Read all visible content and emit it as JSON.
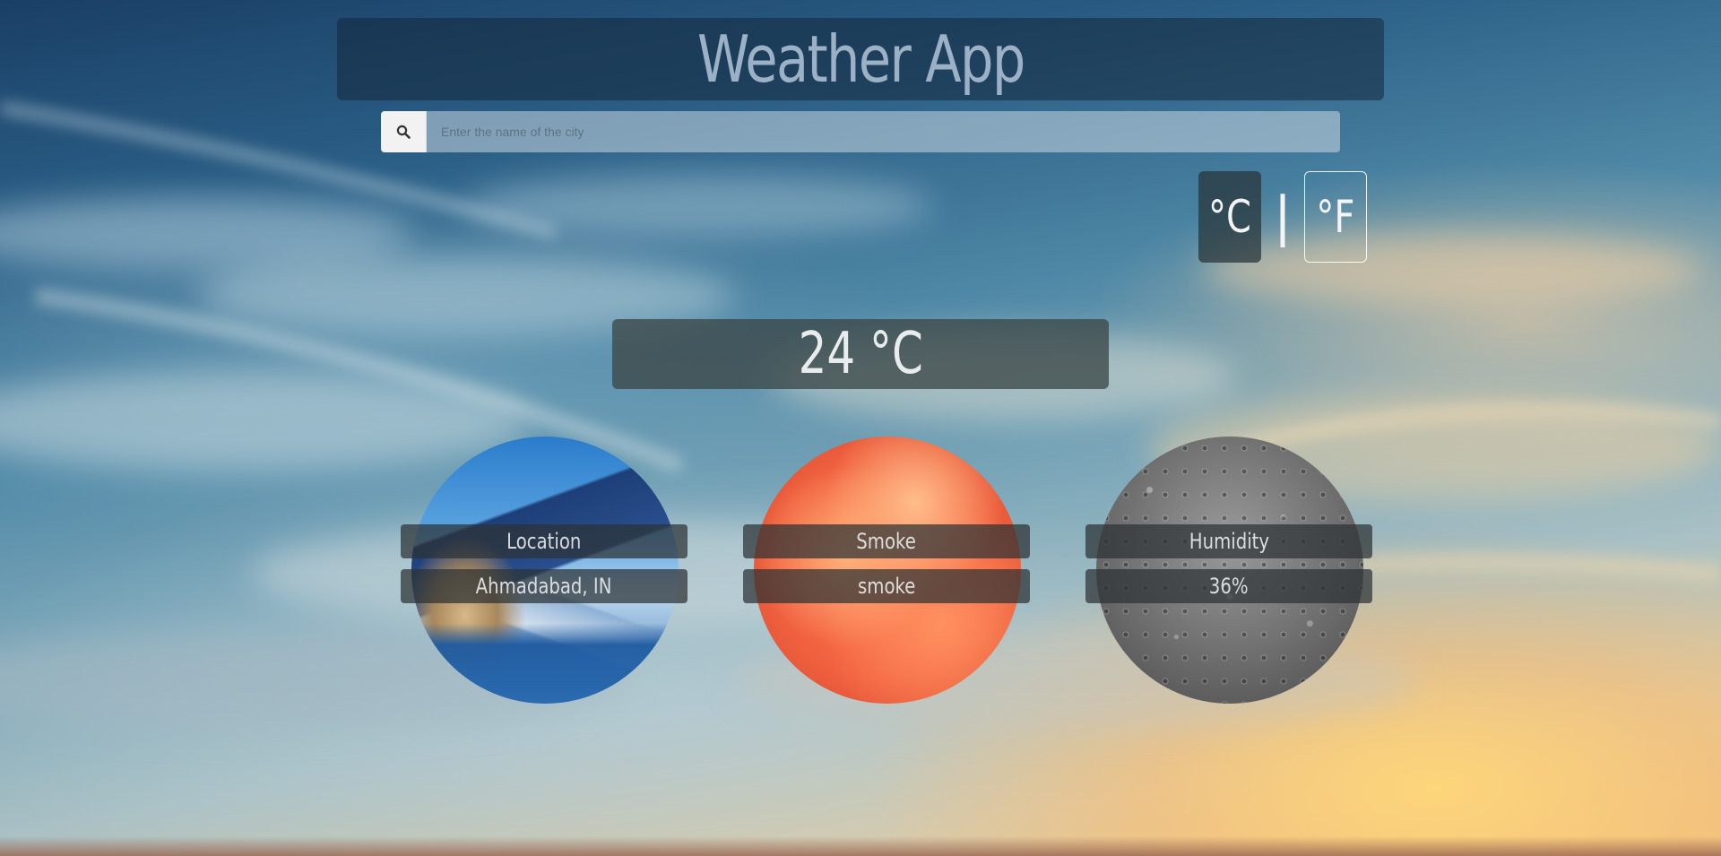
{
  "header": {
    "title": "Weather App"
  },
  "search": {
    "icon": "search-icon",
    "placeholder": "Enter the name of the city",
    "value": ""
  },
  "units": {
    "celsius_label": "°C",
    "separator": "|",
    "fahrenheit_label": "°F",
    "selected": "°C"
  },
  "temperature": {
    "display": "24 °C"
  },
  "cards": {
    "location": {
      "title": "Location",
      "value": "Ahmadabad, IN"
    },
    "condition": {
      "title": "Smoke",
      "value": "smoke"
    },
    "humidity": {
      "title": "Humidity",
      "value": "36%"
    }
  },
  "colors": {
    "header_bg": "#14283c",
    "temp_bg": "#3c4848",
    "label_bg": "#2d3234",
    "smoke_circle": "#f0603e"
  }
}
